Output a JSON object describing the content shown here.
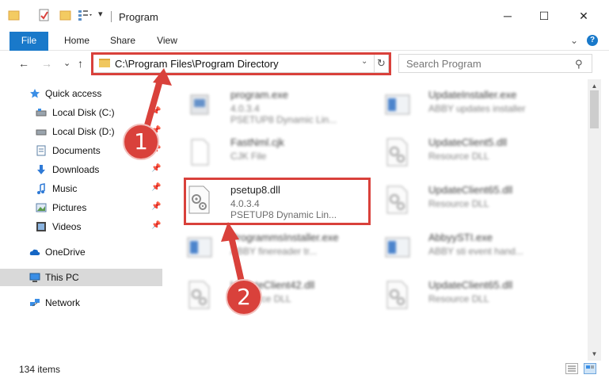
{
  "window": {
    "title": "Program",
    "minimize": "─",
    "maximize": "☐",
    "close": "✕"
  },
  "ribbon": {
    "tabs": [
      "File",
      "Home",
      "Share",
      "View"
    ],
    "expand": "⌄",
    "help": "?"
  },
  "nav": {
    "back": "←",
    "forward": "→",
    "recent": "⌄",
    "up": "↑"
  },
  "address": {
    "path": "C:\\Program Files\\Program Directory",
    "dropdown": "⌄",
    "refresh": "↻"
  },
  "search": {
    "placeholder": "Search Program",
    "icon": "⚲"
  },
  "sidebar": {
    "items": [
      {
        "label": "Quick access",
        "icon": "star-icon",
        "pinned": false
      },
      {
        "label": "Local Disk (C:)",
        "icon": "drive-icon",
        "pinned": true
      },
      {
        "label": "Local Disk (D:)",
        "icon": "drive-icon",
        "pinned": true
      },
      {
        "label": "Documents",
        "icon": "documents-icon",
        "pinned": true
      },
      {
        "label": "Downloads",
        "icon": "download-icon",
        "pinned": true
      },
      {
        "label": "Music",
        "icon": "music-icon",
        "pinned": true
      },
      {
        "label": "Pictures",
        "icon": "pictures-icon",
        "pinned": true
      },
      {
        "label": "Videos",
        "icon": "videos-icon",
        "pinned": true
      },
      {
        "label": "OneDrive",
        "icon": "cloud-icon",
        "pinned": false
      },
      {
        "label": "This PC",
        "icon": "computer-icon",
        "pinned": false,
        "selected": true
      },
      {
        "label": "Network",
        "icon": "network-icon",
        "pinned": false
      }
    ],
    "pin_glyph": "📌"
  },
  "files": {
    "left": [
      {
        "name": "program.exe",
        "line1": "4.0.3.4",
        "line2": "PSETUP8 Dynamic Lin...",
        "icon": "exe-icon"
      },
      {
        "name": "FastNml.cjk",
        "line1": "CJK File",
        "line2": "",
        "icon": "file-icon"
      },
      {
        "name": "psetup8.dll",
        "line1": "4.0.3.4",
        "line2": "PSETUP8 Dynamic Lin...",
        "icon": "dll-icon"
      },
      {
        "name": "ProgrammsInstaller.exe",
        "line1": "ABBY finereader tr...",
        "line2": "",
        "icon": "installer-icon"
      },
      {
        "name": "UpdateClient42.dll",
        "line1": "Resource DLL",
        "line2": "",
        "icon": "dll-icon"
      }
    ],
    "right": [
      {
        "name": "UpdateInstaller.exe",
        "line1": "ABBY updates installer",
        "line2": "",
        "icon": "installer-icon"
      },
      {
        "name": "UpdateClient5.dll",
        "line1": "Resource DLL",
        "line2": "",
        "icon": "dll-icon"
      },
      {
        "name": "UpdateClient65.dll",
        "line1": "Resource DLL",
        "line2": "",
        "icon": "dll-icon"
      },
      {
        "name": "AbbyySTI.exe",
        "line1": "ABBY sti event hand...",
        "line2": "",
        "icon": "installer-icon"
      },
      {
        "name": "UpdateClient65.dll",
        "line1": "Resource DLL",
        "line2": "",
        "icon": "dll-icon"
      }
    ]
  },
  "status": {
    "count": "134 items"
  },
  "annotations": {
    "step1": "1",
    "step2": "2",
    "color": "#d9413b"
  },
  "colors": {
    "accent": "#1979ca",
    "highlight": "#d9413b"
  }
}
